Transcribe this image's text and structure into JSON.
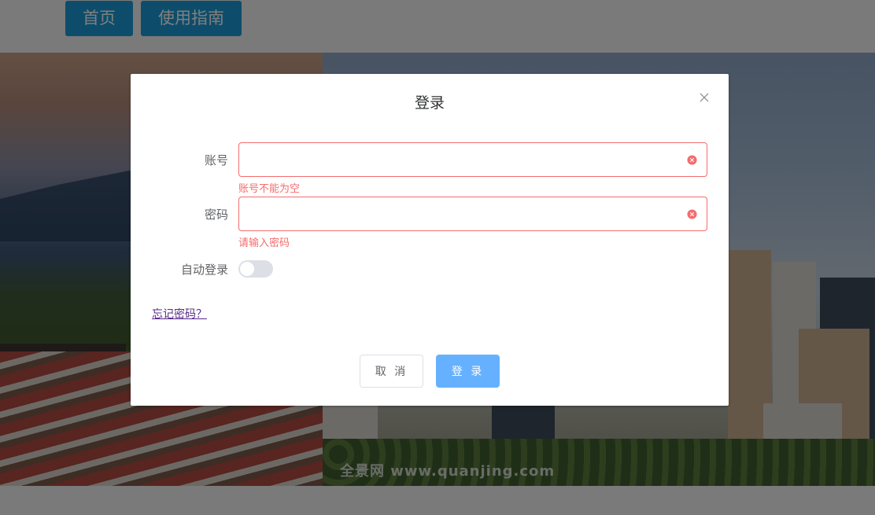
{
  "nav": {
    "home_label": "首页",
    "guide_label": "使用指南"
  },
  "background": {
    "watermark": "全景网 www.quanjing.com"
  },
  "dialog": {
    "title": "登录",
    "account": {
      "label": "账号",
      "value": "",
      "error": "账号不能为空"
    },
    "password": {
      "label": "密码",
      "value": "",
      "error": "请输入密码"
    },
    "auto_login": {
      "label": "自动登录",
      "enabled": false
    },
    "forgot_password_link": "忘记密码？",
    "cancel_label": "取 消",
    "login_label": "登 录"
  },
  "colors": {
    "nav_button": "#1a9bd7",
    "error": "#f56c6c",
    "primary_button": "#66b1ff",
    "switch_off": "#dcdfe6",
    "link": "#5a2a8a"
  },
  "icons": {
    "close": "close-icon",
    "clear_account": "circle-close-icon",
    "clear_password": "circle-close-icon"
  }
}
